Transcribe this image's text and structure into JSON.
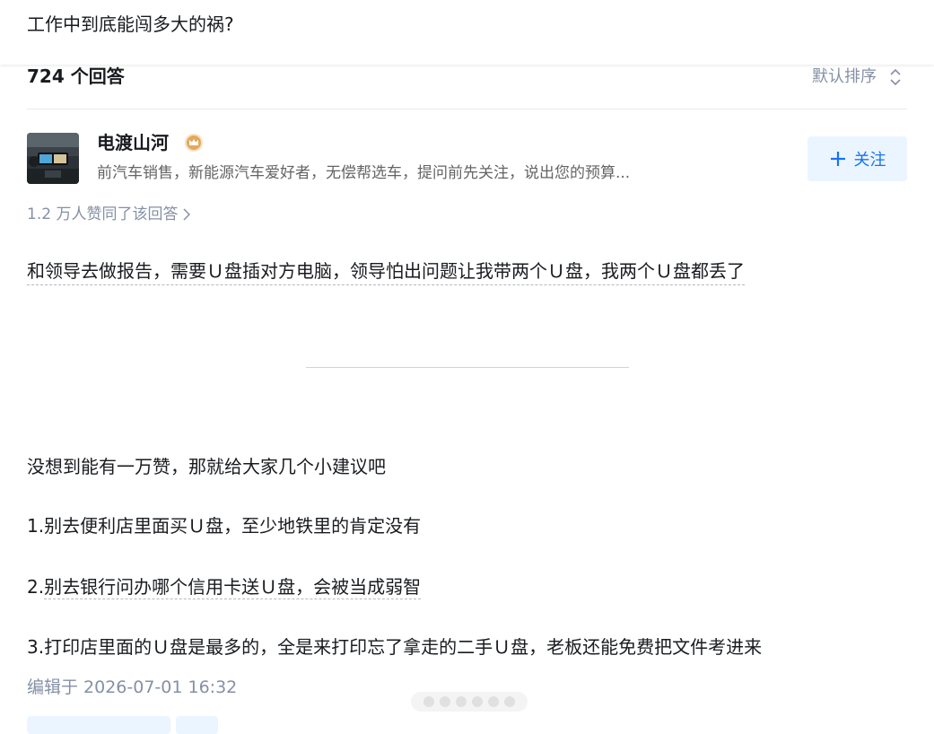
{
  "question": {
    "title": "工作中到底能闯多大的祸?"
  },
  "answers_header": {
    "count_label": "724 个回答",
    "sort_label": "默认排序"
  },
  "author": {
    "name": "电渡山河",
    "bio": "前汽车销售，新能源汽车爱好者，无偿帮选车，提问前先关注，说出您的预算...",
    "follow_label": "关注",
    "badge_color": "#e4a85a"
  },
  "answer": {
    "votes_summary": "1.2 万人赞同了该回答",
    "p1": "和领导去做报告，需要Ｕ盘插对方电脑，领导怕出问题让我带两个Ｕ盘，我两个Ｕ盘都丢了",
    "p2": "没想到能有一万赞，那就给大家几个小建议吧",
    "p3": "1.别去便利店里面买Ｕ盘，至少地铁里的肯定没有",
    "p4_num": "2.",
    "p4_text": "别去银行问办哪个信用卡送Ｕ盘，会被当成弱智",
    "p5": "3.打印店里面的Ｕ盘是最多的，全是来打印忘了拿走的二手Ｕ盘，老板还能免费把文件考进来",
    "edited": "编辑于 2026-07-01 16:32"
  },
  "colors": {
    "accent": "#1772f6",
    "accent_bg": "#ebf5ff",
    "muted": "#8590a6",
    "text": "#191b1f"
  }
}
